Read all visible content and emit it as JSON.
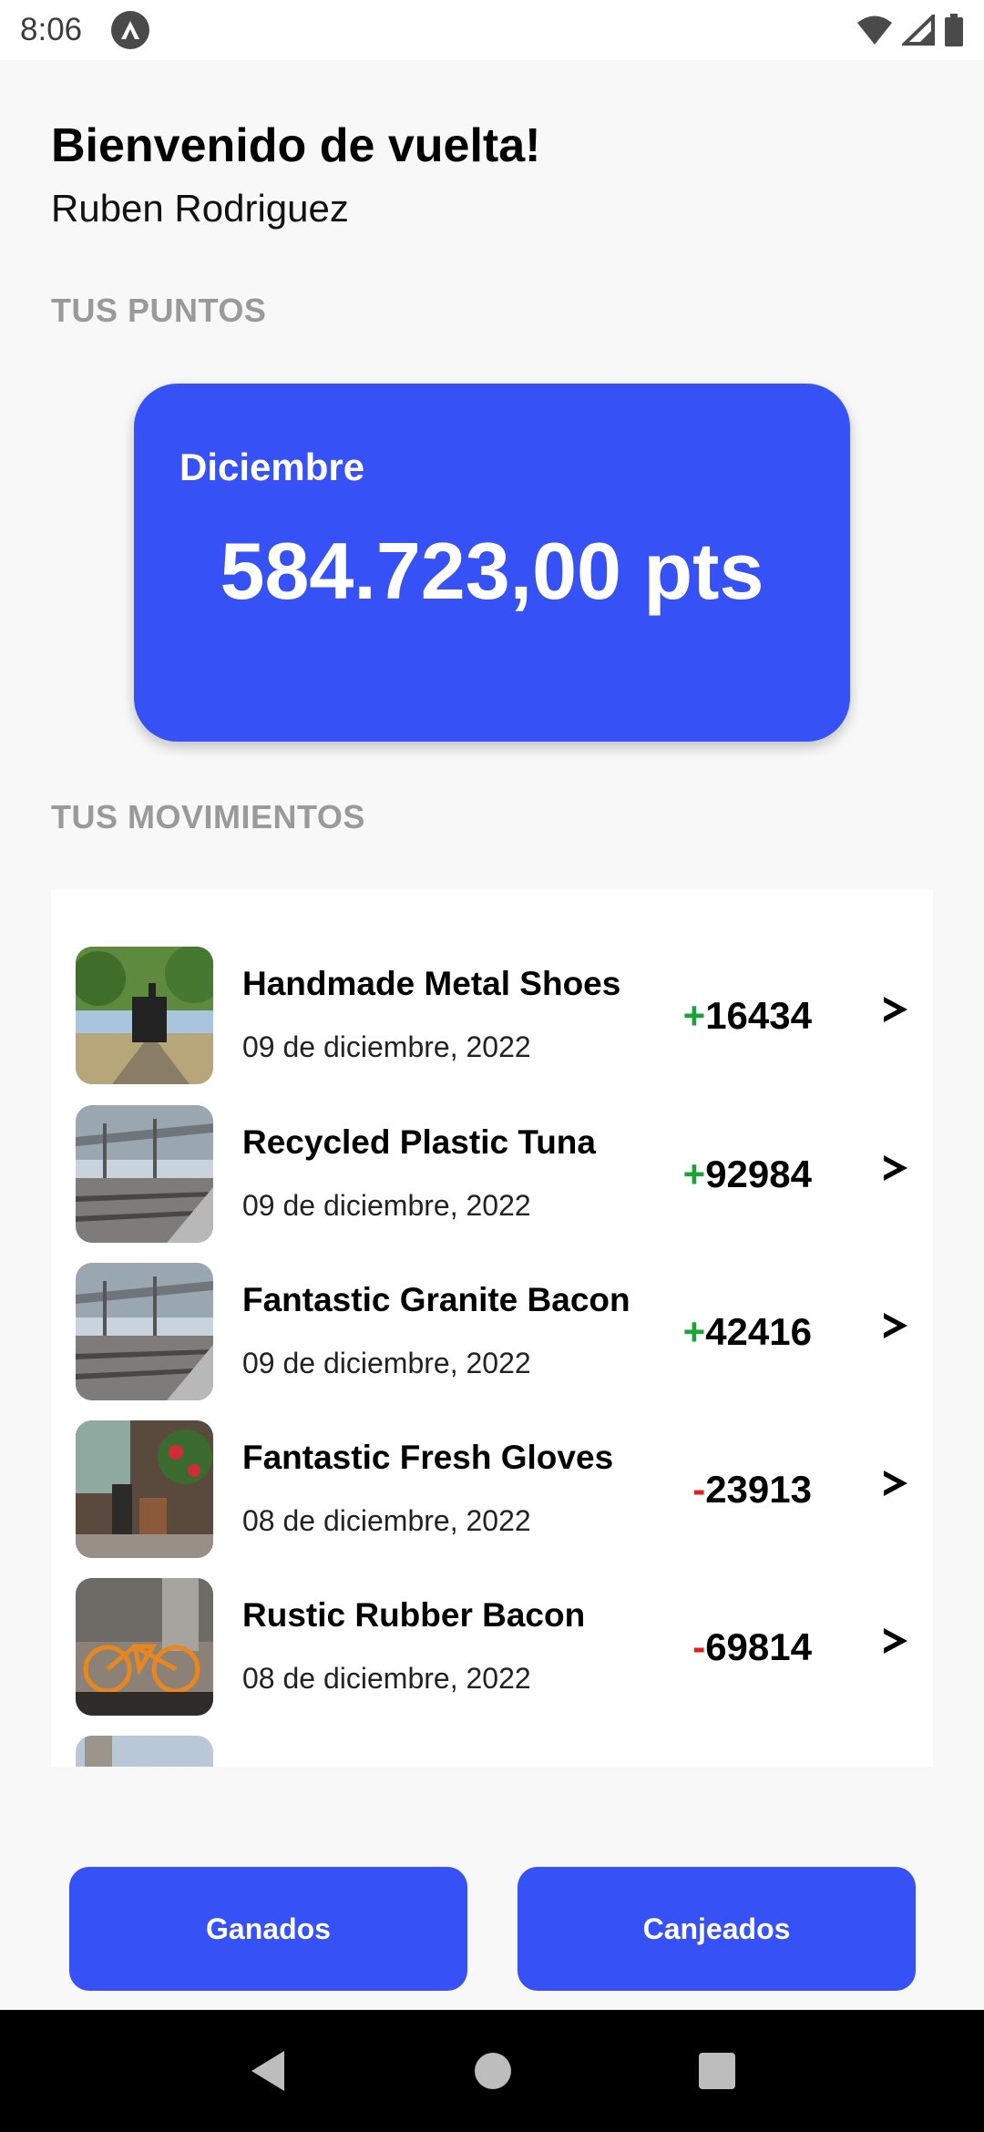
{
  "status_bar": {
    "time": "8:06"
  },
  "header": {
    "greeting": "Bienvenido de vuelta!",
    "user_name": "Ruben Rodriguez"
  },
  "points_section": {
    "label": "TUS PUNTOS",
    "month": "Diciembre",
    "value": "584.723,00 pts"
  },
  "movements_section": {
    "label": "TUS MOVIMIENTOS",
    "items": [
      {
        "title": "Handmade Metal Shoes",
        "date": "09 de diciembre, 2022",
        "sign": "+",
        "amount": "16434",
        "image": "train-photo"
      },
      {
        "title": "Recycled Plastic Tuna",
        "date": "09 de diciembre, 2022",
        "sign": "+",
        "amount": "92984",
        "image": "station-photo"
      },
      {
        "title": "Fantastic Granite Bacon",
        "date": "09 de diciembre, 2022",
        "sign": "+",
        "amount": "42416",
        "image": "station-photo"
      },
      {
        "title": "Fantastic Fresh Gloves",
        "date": "08 de diciembre, 2022",
        "sign": "-",
        "amount": "23913",
        "image": "street-cafe-photo"
      },
      {
        "title": "Rustic Rubber Bacon",
        "date": "08 de diciembre, 2022",
        "sign": "-",
        "amount": "69814",
        "image": "bicycle-photo"
      }
    ]
  },
  "buttons": {
    "earned": "Ganados",
    "redeemed": "Canjeados"
  },
  "colors": {
    "primary": "#3651f6",
    "positive": "#1aa33b",
    "negative": "#e02020",
    "section_label": "#9a9a9a"
  }
}
